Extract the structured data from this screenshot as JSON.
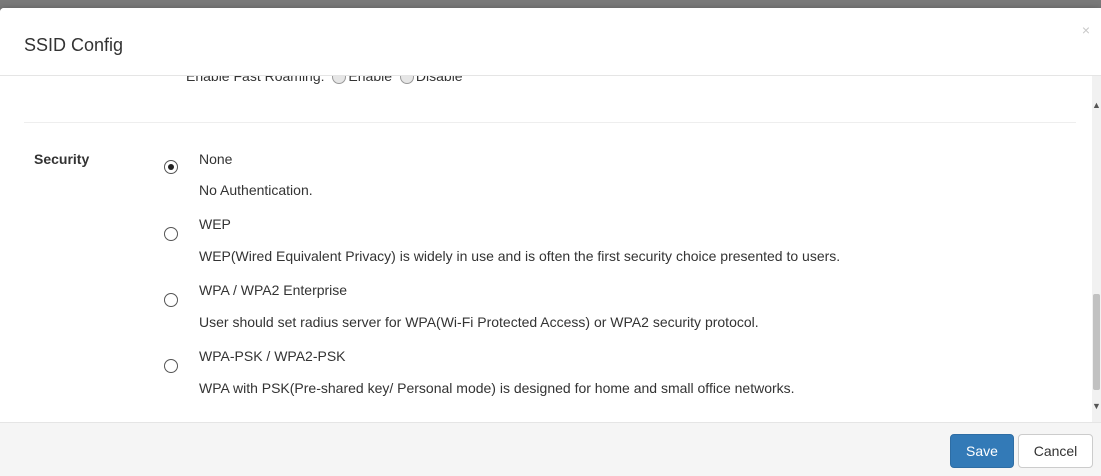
{
  "dialog": {
    "title": "SSID Config",
    "close_glyph": "×"
  },
  "fast_roaming": {
    "label": "Enable Fast Roaming:",
    "enable_label": "Enable",
    "disable_label": "Disable"
  },
  "security": {
    "label": "Security",
    "selected": "None",
    "options": [
      {
        "title": "None",
        "description": "No Authentication."
      },
      {
        "title": "WEP",
        "description": "WEP(Wired Equivalent Privacy) is widely in use and is often the first security choice presented to users."
      },
      {
        "title": "WPA / WPA2 Enterprise",
        "description": "User should set radius server for WPA(Wi-Fi Protected Access) or WPA2 security protocol."
      },
      {
        "title": "WPA-PSK / WPA2-PSK",
        "description": "WPA with PSK(Pre-shared key/ Personal mode) is designed for home and small office networks."
      }
    ]
  },
  "footer": {
    "save_label": "Save",
    "cancel_label": "Cancel"
  },
  "colors": {
    "primary": "#337ab7",
    "footer_bg": "#f5f5f5",
    "overlay": "#7a7a7a"
  }
}
